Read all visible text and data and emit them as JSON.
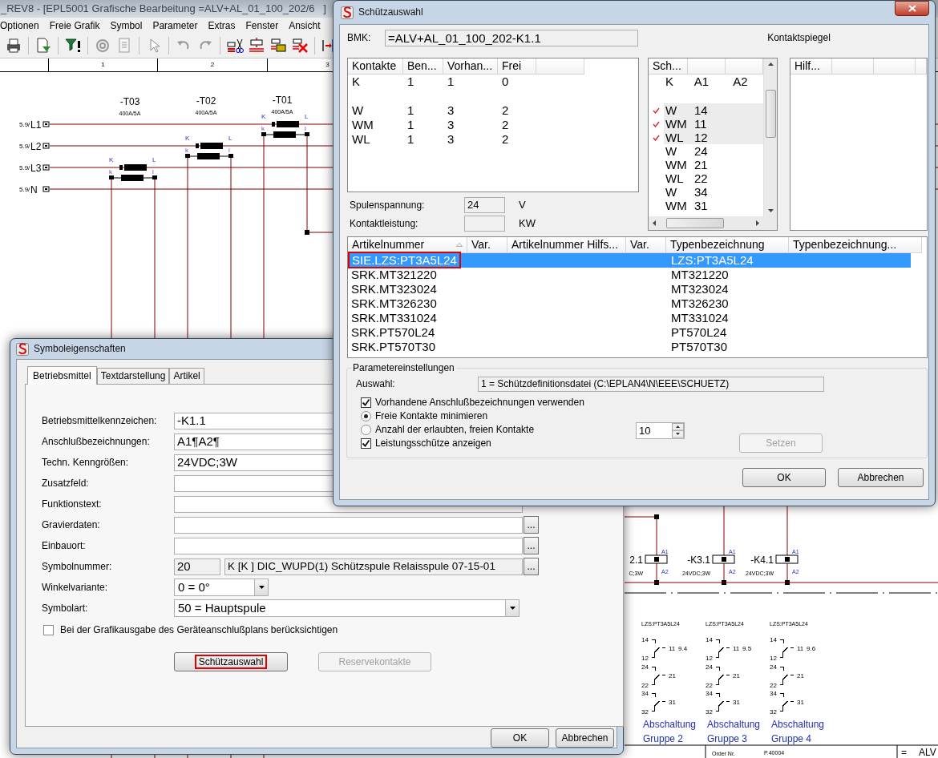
{
  "app": {
    "title": "_REV8 - [EPL5001 Grafische Bearbeitung =ALV+AL_01_100_202/6   ]",
    "menu": [
      "Optionen",
      "Freie Grafik",
      "Symbol",
      "Parameter",
      "Extras",
      "Fenster",
      "Ansicht"
    ],
    "ruler": [
      "1",
      "2",
      "3"
    ]
  },
  "schematic": {
    "busbars": [
      {
        "ref": "5.9/",
        "name": "L1"
      },
      {
        "ref": "5.9/",
        "name": "L2"
      },
      {
        "ref": "5.9/",
        "name": "L3"
      },
      {
        "ref": "5.9/",
        "name": "N"
      }
    ],
    "transformers": [
      {
        "name": "-T03",
        "rating": "400A/5A",
        "terminals": [
          "K",
          "L",
          "k",
          "l"
        ]
      },
      {
        "name": "-T02",
        "rating": "400A/5A",
        "terminals": [
          "K",
          "L",
          "k",
          "l"
        ]
      },
      {
        "name": "-T01",
        "rating": "400A/5A",
        "terminals": [
          "K",
          "L",
          "k",
          "l"
        ]
      }
    ],
    "coils": [
      {
        "name": "2.1",
        "spec": "C;3W",
        "pins": [
          "A1",
          "A2"
        ]
      },
      {
        "name": "-K3.1",
        "spec": "24VDC;3W",
        "pins": [
          "A1",
          "A2"
        ]
      },
      {
        "name": "-K4.1",
        "spec": "24VDC;3W",
        "pins": [
          "A1",
          "A2"
        ]
      }
    ],
    "contact_mirrors": [
      {
        "type": "LZS:PT3A5L24",
        "ref": "9.4",
        "contacts": [
          [
            "14",
            "12",
            "11"
          ],
          [
            "24",
            "22",
            "21"
          ],
          [
            "34",
            "32",
            "31"
          ]
        ],
        "caption": [
          "Abschaltung",
          "Gruppe 2"
        ]
      },
      {
        "type": "LZS:PT3A5L24",
        "ref": "9.5",
        "contacts": [
          [
            "14",
            "12",
            "11"
          ],
          [
            "24",
            "22",
            "21"
          ],
          [
            "34",
            "32",
            "31"
          ]
        ],
        "caption": [
          "Abschaltung",
          "Gruppe 3"
        ]
      },
      {
        "type": "LZS:PT3A5L24",
        "ref": "9.6",
        "contacts": [
          [
            "14",
            "12",
            "11"
          ],
          [
            "24",
            "22",
            "21"
          ],
          [
            "34",
            "32",
            "31"
          ]
        ],
        "caption": [
          "Abschaltung",
          "Gruppe 4"
        ]
      }
    ],
    "title_block": {
      "order_label": "Order Nr.",
      "order": "P.40004",
      "equals": "=",
      "plant": "ALV"
    }
  },
  "contactor_dialog": {
    "title": "Schützauswahl",
    "bmk_label": "BMK:",
    "bmk": "=ALV+AL_01_100_202-K1.1",
    "mirror_label": "Kontaktspiegel",
    "contacts_table": {
      "columns": [
        "Kontakte",
        "Ben...",
        "Vorhan...",
        "Frei"
      ],
      "rows": [
        {
          "kind": "row",
          "cells": [
            "K",
            "1",
            "1",
            "0"
          ]
        },
        {
          "kind": "gap"
        },
        {
          "kind": "row",
          "cells": [
            "W",
            "1",
            "3",
            "2"
          ]
        },
        {
          "kind": "row",
          "cells": [
            "WM",
            "1",
            "3",
            "2"
          ]
        },
        {
          "kind": "row",
          "cells": [
            "WL",
            "1",
            "3",
            "2"
          ]
        }
      ]
    },
    "mirror_list": {
      "columns": [
        "Sch..."
      ],
      "rows": [
        {
          "kind": "row",
          "checked": false,
          "cells": [
            "K",
            "A1",
            "A2"
          ]
        },
        {
          "kind": "gap"
        },
        {
          "kind": "row",
          "checked": true,
          "cells": [
            "W",
            "14"
          ]
        },
        {
          "kind": "row",
          "checked": true,
          "cells": [
            "WM",
            "11"
          ]
        },
        {
          "kind": "row",
          "checked": true,
          "cells": [
            "WL",
            "12"
          ]
        },
        {
          "kind": "row",
          "checked": false,
          "cells": [
            "W",
            "24"
          ]
        },
        {
          "kind": "row",
          "checked": false,
          "cells": [
            "WM",
            "21"
          ]
        },
        {
          "kind": "row",
          "checked": false,
          "cells": [
            "WL",
            "22"
          ]
        },
        {
          "kind": "row",
          "checked": false,
          "cells": [
            "W",
            "34"
          ]
        },
        {
          "kind": "row",
          "checked": false,
          "cells": [
            "WM",
            "31"
          ]
        }
      ]
    },
    "aux_list": {
      "columns": [
        "Hilf..."
      ]
    },
    "coil_voltage": {
      "label": "Spulenspannung:",
      "value": "24",
      "unit": "V"
    },
    "contact_power": {
      "label": "Kontaktleistung:",
      "unit": "KW"
    },
    "articles": {
      "columns": [
        {
          "label": "Artikelnummer",
          "sorted": true
        },
        {
          "label": "Var.",
          "sorted": false
        },
        {
          "label": "Artikelnummer Hilfs...",
          "sorted": false
        },
        {
          "label": "Var.",
          "sorted": false
        },
        {
          "label": "Typenbezeichnung",
          "sorted": false
        },
        {
          "label": "Typenbezeichnung...",
          "sorted": false
        }
      ],
      "rows": [
        {
          "selected": true,
          "marked": true,
          "article": "SIE.LZS:PT3A5L24",
          "type": "LZS:PT3A5L24"
        },
        {
          "selected": false,
          "marked": false,
          "article": "SRK.MT321220",
          "type": "MT321220"
        },
        {
          "selected": false,
          "marked": false,
          "article": "SRK.MT323024",
          "type": "MT323024"
        },
        {
          "selected": false,
          "marked": false,
          "article": "SRK.MT326230",
          "type": "MT326230"
        },
        {
          "selected": false,
          "marked": false,
          "article": "SRK.MT331024",
          "type": "MT331024"
        },
        {
          "selected": false,
          "marked": false,
          "article": "SRK.PT570L24",
          "type": "PT570L24"
        },
        {
          "selected": false,
          "marked": false,
          "article": "SRK.PT570T30",
          "type": "PT570T30"
        }
      ]
    },
    "params": {
      "legend": "Parametereinstellungen",
      "selection_label": "Auswahl:",
      "selection": "1 = Schützdefinitionsdatei (C:\\EPLAN4\\N\\EEE\\SCHUETZ)",
      "options": [
        {
          "kind": "checkbox",
          "label": "Vorhandene Anschlußbezeichnungen verwenden",
          "checked": true
        },
        {
          "kind": "radio",
          "label": "Freie Kontakte minimieren",
          "selected": true
        },
        {
          "kind": "radio",
          "label": "Anzahl der erlaubten, freien Kontakte",
          "selected": false
        },
        {
          "kind": "checkbox",
          "label": "Leistungsschütze anzeigen",
          "checked": true
        }
      ],
      "count": "10",
      "set_button": {
        "label": "Setzen",
        "disabled": true
      }
    },
    "buttons": [
      "OK",
      "Abbrechen"
    ]
  },
  "symbol_dialog": {
    "title": "Symboleigenschaften",
    "tabs": [
      {
        "label": "Betriebsmittel",
        "selected": true
      },
      {
        "label": "Textdarstellung",
        "selected": false
      },
      {
        "label": "Artikel",
        "selected": false
      }
    ],
    "fields": [
      {
        "kind": "text",
        "label": "Betriebsmittelkennzeichen:",
        "value": "-K1.1"
      },
      {
        "kind": "text",
        "label": "Anschlußbezeichnungen:",
        "value": "A1¶A2¶"
      },
      {
        "kind": "text",
        "label": "Techn. Kenngrößen:",
        "value": "24VDC;3W"
      },
      {
        "kind": "text",
        "label": "Zusatzfeld:"
      },
      {
        "kind": "text",
        "label": "Funktionstext:"
      },
      {
        "kind": "browse",
        "label": "Gravierdaten:",
        "button": "..."
      },
      {
        "kind": "browse",
        "label": "Einbauort:",
        "button": "..."
      },
      {
        "kind": "symbol",
        "label": "Symbolnummer:",
        "value": "20",
        "description": "K [K  ] DIC_WUPD(1) Schützspule Relaisspule 07-15-01",
        "button": "..."
      },
      {
        "kind": "minicombo",
        "label": "Winkelvariante:",
        "value": "0 = 0°"
      },
      {
        "kind": "combo",
        "label": "Symbolart:",
        "value": "50 = Hauptspule"
      }
    ],
    "checkbox": {
      "label": "Bei der Grafikausgabe des Geräteanschlußplans berücksichtigen",
      "checked": false
    },
    "action_buttons": [
      {
        "label": "Schützauswahl",
        "disabled": false,
        "marked": true
      },
      {
        "label": "Reservekontakte",
        "disabled": true,
        "marked": false
      }
    ],
    "buttons": [
      "OK",
      "Abbrechen"
    ]
  }
}
